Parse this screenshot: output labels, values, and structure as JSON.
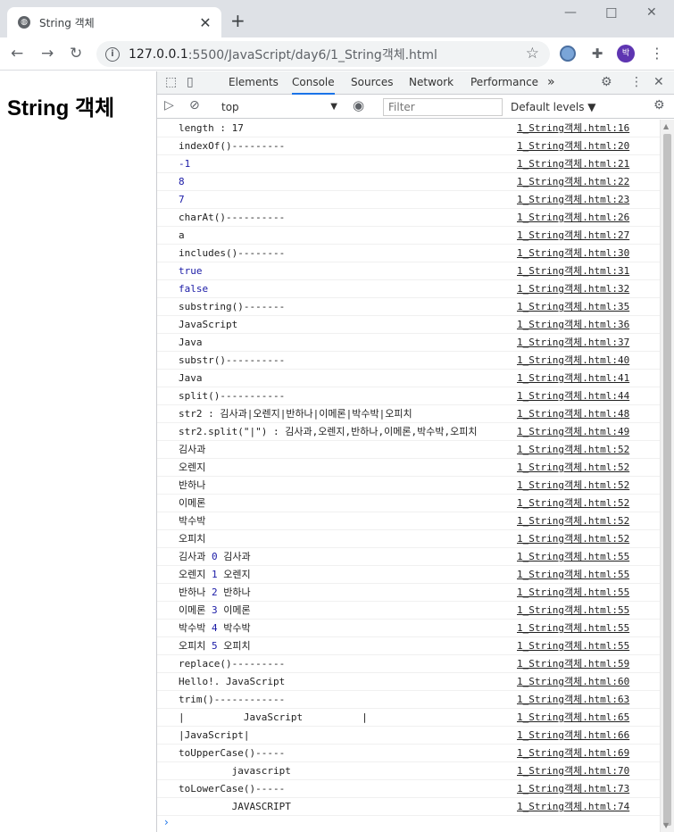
{
  "browser": {
    "tab_title": "String 객체",
    "url_host": "127.0.0.1",
    "url_path": ":5500/JavaScript/day6/1_String객체.html",
    "profile_initial": "박"
  },
  "page": {
    "heading": "String 객체"
  },
  "devtools": {
    "tabs": [
      "Elements",
      "Console",
      "Sources",
      "Network",
      "Performance",
      "»"
    ],
    "context": "top",
    "filter_placeholder": "Filter",
    "levels": "Default levels ▼",
    "prompt": "›"
  },
  "console_rows": [
    {
      "msg": "length : 17",
      "num": false,
      "src": "1_String객체.html:16"
    },
    {
      "msg": "indexOf()---------",
      "num": false,
      "src": "1_String객체.html:20"
    },
    {
      "msg": "-1",
      "num": true,
      "src": "1_String객체.html:21"
    },
    {
      "msg": "8",
      "num": true,
      "src": "1_String객체.html:22"
    },
    {
      "msg": "7",
      "num": true,
      "src": "1_String객체.html:23"
    },
    {
      "msg": "charAt()----------",
      "num": false,
      "src": "1_String객체.html:26"
    },
    {
      "msg": "a",
      "num": false,
      "src": "1_String객체.html:27"
    },
    {
      "msg": "includes()--------",
      "num": false,
      "src": "1_String객체.html:30"
    },
    {
      "msg": "true",
      "num": true,
      "src": "1_String객체.html:31"
    },
    {
      "msg": "false",
      "num": true,
      "src": "1_String객체.html:32"
    },
    {
      "msg": "substring()-------",
      "num": false,
      "src": "1_String객체.html:35"
    },
    {
      "msg": "JavaScript",
      "num": false,
      "src": "1_String객체.html:36"
    },
    {
      "msg": "Java",
      "num": false,
      "src": "1_String객체.html:37"
    },
    {
      "msg": "substr()----------",
      "num": false,
      "src": "1_String객체.html:40"
    },
    {
      "msg": "Java",
      "num": false,
      "src": "1_String객체.html:41"
    },
    {
      "msg": "split()-----------",
      "num": false,
      "src": "1_String객체.html:44"
    },
    {
      "msg": "str2 : 김사과|오렌지|반하나|이메론|박수박|오피치",
      "num": false,
      "src": "1_String객체.html:48"
    },
    {
      "msg": "str2.split(\"|\") : 김사과,오렌지,반하나,이메론,박수박,오피치",
      "num": false,
      "src": "1_String객체.html:49"
    },
    {
      "msg": "김사과",
      "num": false,
      "src": "1_String객체.html:52"
    },
    {
      "msg": "오렌지",
      "num": false,
      "src": "1_String객체.html:52"
    },
    {
      "msg": "반하나",
      "num": false,
      "src": "1_String객체.html:52"
    },
    {
      "msg": "이메론",
      "num": false,
      "src": "1_String객체.html:52"
    },
    {
      "msg": "박수박",
      "num": false,
      "src": "1_String객체.html:52"
    },
    {
      "msg": "오피치",
      "num": false,
      "src": "1_String객체.html:52"
    },
    {
      "parts": [
        "김사과 ",
        "0",
        " 김사과"
      ],
      "src": "1_String객체.html:55"
    },
    {
      "parts": [
        "오렌지 ",
        "1",
        " 오렌지"
      ],
      "src": "1_String객체.html:55"
    },
    {
      "parts": [
        "반하나 ",
        "2",
        " 반하나"
      ],
      "src": "1_String객체.html:55"
    },
    {
      "parts": [
        "이메론 ",
        "3",
        " 이메론"
      ],
      "src": "1_String객체.html:55"
    },
    {
      "parts": [
        "박수박 ",
        "4",
        " 박수박"
      ],
      "src": "1_String객체.html:55"
    },
    {
      "parts": [
        "오피치 ",
        "5",
        " 오피치"
      ],
      "src": "1_String객체.html:55"
    },
    {
      "msg": "replace()---------",
      "num": false,
      "src": "1_String객체.html:59"
    },
    {
      "msg": "Hello!. JavaScript",
      "num": false,
      "src": "1_String객체.html:60"
    },
    {
      "msg": "trim()------------",
      "num": false,
      "src": "1_String객체.html:63"
    },
    {
      "msg": "|          JavaScript          |",
      "num": false,
      "src": "1_String객체.html:65"
    },
    {
      "msg": "|JavaScript|",
      "num": false,
      "src": "1_String객체.html:66"
    },
    {
      "msg": "toUpperCase()-----",
      "num": false,
      "src": "1_String객체.html:69"
    },
    {
      "msg": "         javascript",
      "num": false,
      "src": "1_String객체.html:70"
    },
    {
      "msg": "toLowerCase()-----",
      "num": false,
      "src": "1_String객체.html:73"
    },
    {
      "msg": "         JAVASCRIPT",
      "num": false,
      "src": "1_String객체.html:74"
    }
  ]
}
